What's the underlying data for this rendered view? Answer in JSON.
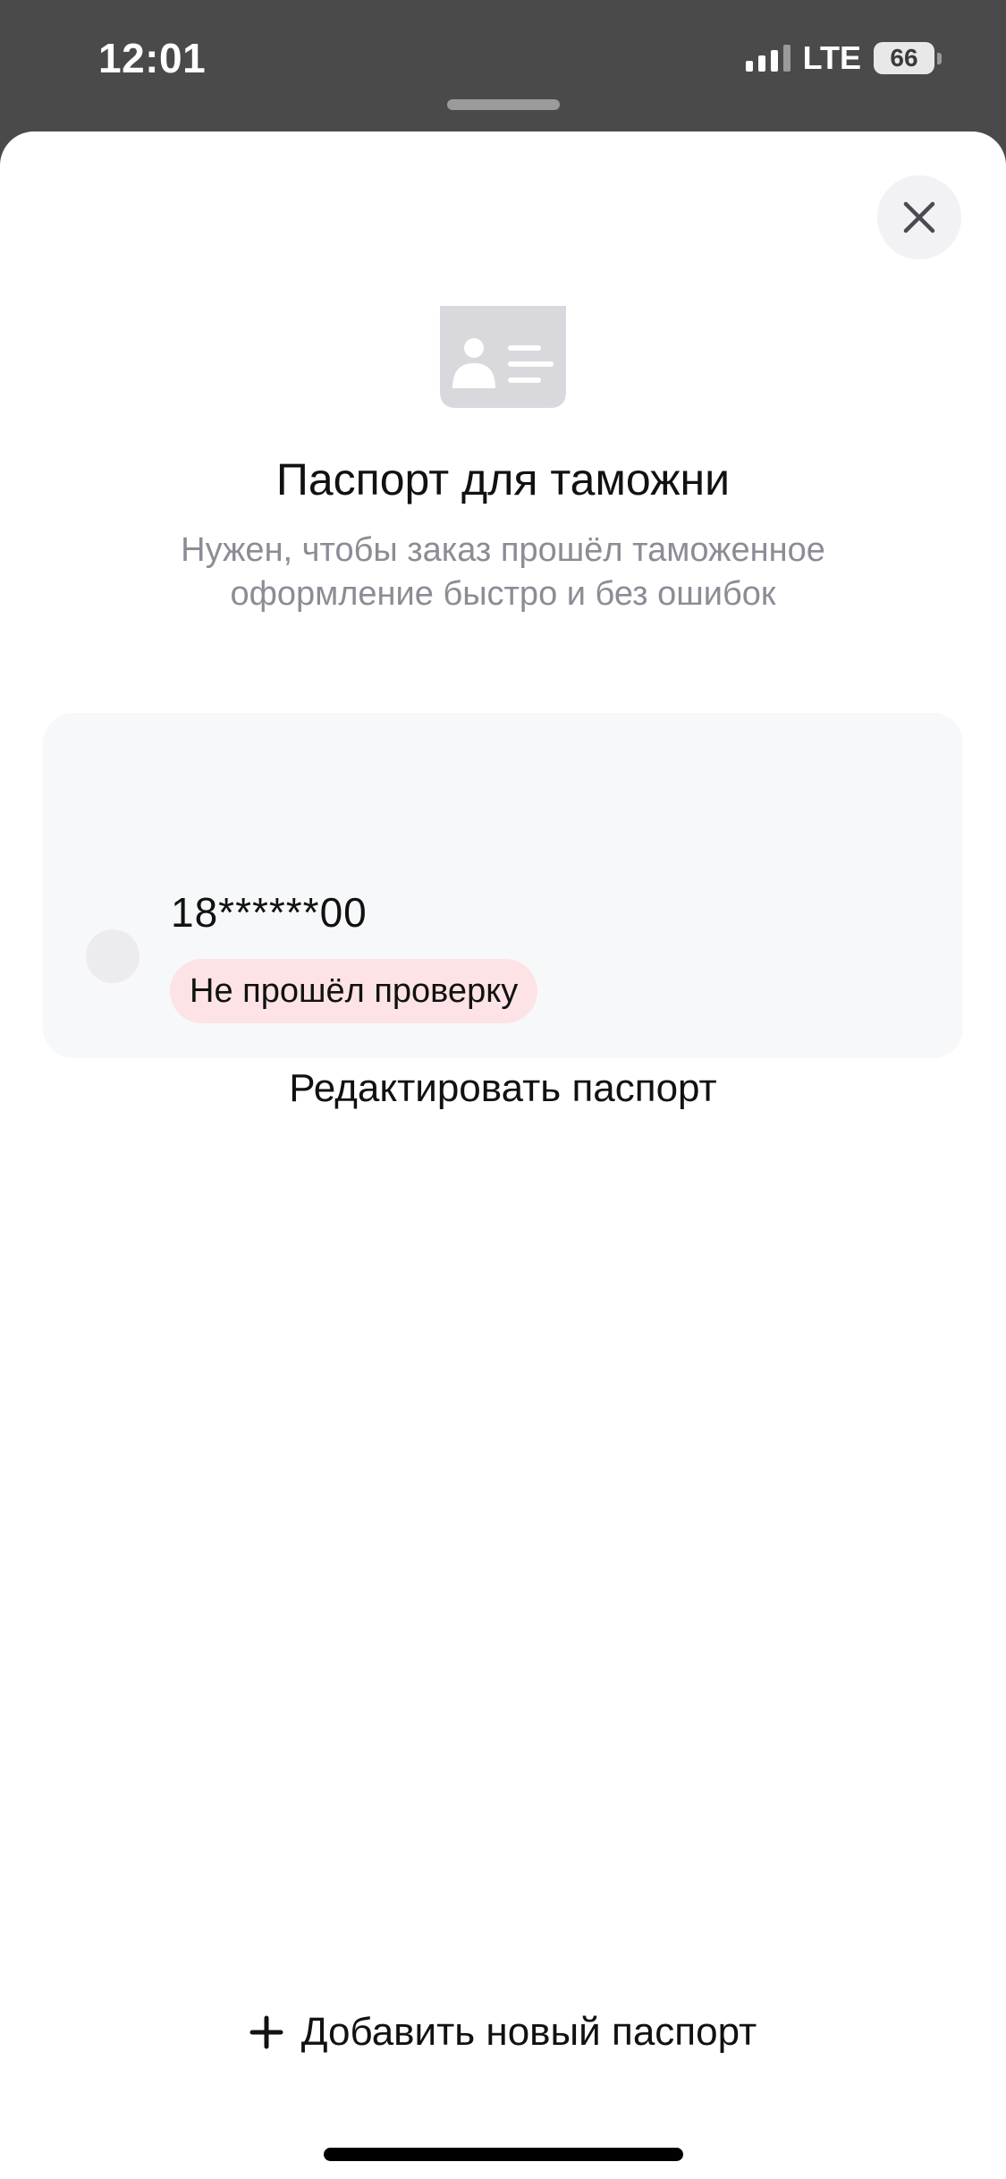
{
  "status_bar": {
    "time": "12:01",
    "network": "LTE",
    "battery": "66",
    "signal_bars_active": 3,
    "signal_bars_total": 4
  },
  "sheet": {
    "icon": "id-card-icon",
    "title": "Паспорт для таможни",
    "subtitle": "Нужен, чтобы заказ прошёл таможенное оформление быстро и без ошибок",
    "close_icon": "close-icon"
  },
  "passport_card": {
    "number": "18******00",
    "status": "Не прошёл проверку",
    "edit_label": "Редактировать паспорт",
    "selected": false
  },
  "add_passport": {
    "icon": "plus-icon",
    "label": "Добавить новый паспорт"
  },
  "colors": {
    "status_bar_bg": "#4a4a4a",
    "sheet_bg": "#ffffff",
    "card_bg": "#f7f8fa",
    "badge_bg": "#fde3e5",
    "subtitle_text": "#8c8c96",
    "icon_gray": "#d8d8dc"
  }
}
